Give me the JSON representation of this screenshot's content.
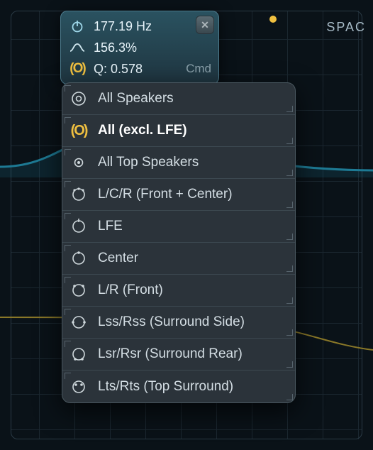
{
  "header": {
    "freq": "177.19 Hz",
    "gain": "156.3%",
    "q": "Q: 0.578",
    "mod": "Cmd"
  },
  "corner_label": "SPAC",
  "menu": {
    "items": [
      {
        "icon": "all-speakers",
        "label": "All Speakers"
      },
      {
        "icon": "all-excl-lfe",
        "label": "All (excl. LFE)",
        "selected": true
      },
      {
        "icon": "top-speakers",
        "label": "All Top Speakers"
      },
      {
        "icon": "lcr",
        "label": "L/C/R (Front + Center)"
      },
      {
        "icon": "lfe",
        "label": "LFE"
      },
      {
        "icon": "center",
        "label": "Center"
      },
      {
        "icon": "lr",
        "label": "L/R (Front)"
      },
      {
        "icon": "surround-side",
        "label": "Lss/Rss (Surround Side)"
      },
      {
        "icon": "surround-rear",
        "label": "Lsr/Rsr (Surround Rear)"
      },
      {
        "icon": "top-surround",
        "label": "Lts/Rts (Top Surround)"
      }
    ]
  },
  "colors": {
    "accent": "#f0c040",
    "cyan": "#2aa8c8"
  }
}
